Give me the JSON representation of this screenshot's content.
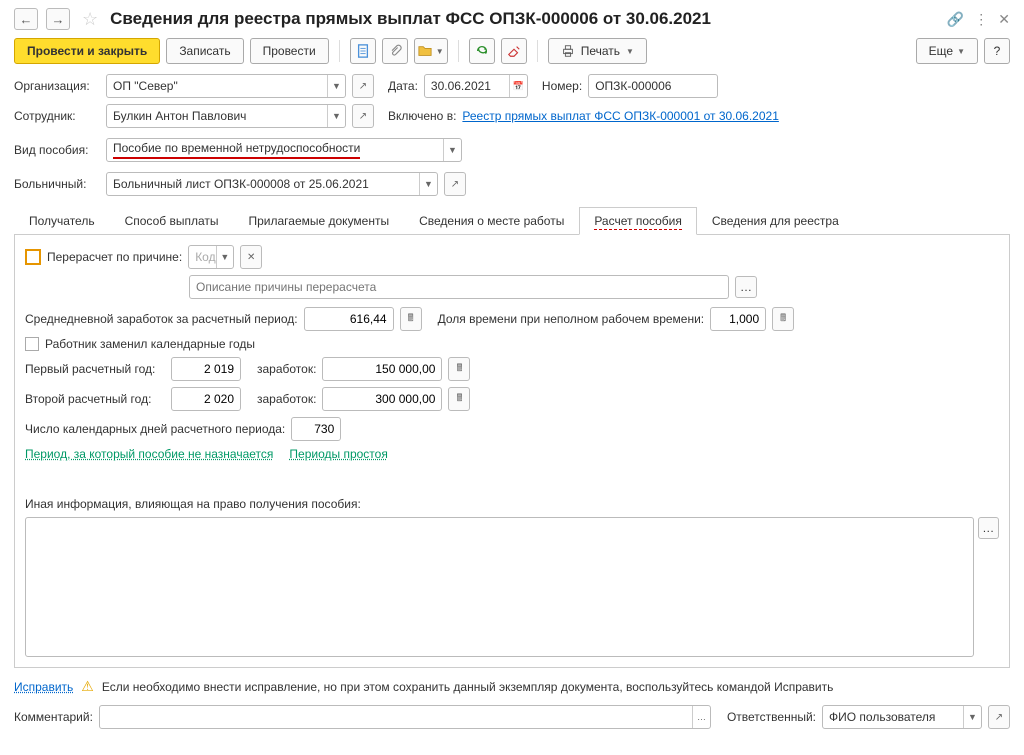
{
  "title": "Сведения для реестра прямых выплат ФСС ОПЗК-000006 от 30.06.2021",
  "toolbar": {
    "post_close": "Провести и закрыть",
    "save": "Записать",
    "post": "Провести",
    "print": "Печать",
    "more": "Еще"
  },
  "form": {
    "org_label": "Организация:",
    "org_value": "ОП \"Север\"",
    "date_label": "Дата:",
    "date_value": "30.06.2021",
    "num_label": "Номер:",
    "num_value": "ОПЗК-000006",
    "emp_label": "Сотрудник:",
    "emp_value": "Булкин Антон Павлович",
    "included_label": "Включено в:",
    "included_link": "Реестр прямых выплат ФСС ОПЗК-000001 от 30.06.2021",
    "benefit_label": "Вид пособия:",
    "benefit_value": "Пособие по временной нетрудоспособности",
    "sick_label": "Больничный:",
    "sick_value": "Больничный лист ОПЗК-000008 от 25.06.2021"
  },
  "tabs": [
    "Получатель",
    "Способ выплаты",
    "Прилагаемые документы",
    "Сведения о месте работы",
    "Расчет пособия",
    "Сведения для реестра"
  ],
  "calc": {
    "recalc_label": "Перерасчет по причине:",
    "code_placeholder": "Код",
    "reason_placeholder": "Описание причины перерасчета",
    "avg_label": "Среднедневной заработок за расчетный период:",
    "avg_value": "616,44",
    "share_label": "Доля времени при неполном рабочем времени:",
    "share_value": "1,000",
    "replaced_label": "Работник заменил календарные годы",
    "year1_label": "Первый расчетный год:",
    "year1_value": "2 019",
    "year2_label": "Второй расчетный год:",
    "year2_value": "2 020",
    "earn_label": "заработок:",
    "earn1_value": "150 000,00",
    "earn2_value": "300 000,00",
    "days_label": "Число календарных дней расчетного периода:",
    "days_value": "730",
    "link1": "Период, за который пособие не назначается",
    "link2": "Периоды простоя",
    "other_label": "Иная информация, влияющая на право получения пособия:"
  },
  "footer": {
    "fix_link": "Исправить",
    "fix_text": "Если необходимо внести исправление, но при этом сохранить данный экземпляр документа, воспользуйтесь командой Исправить",
    "comment_label": "Комментарий:",
    "resp_label": "Ответственный:",
    "resp_value": "ФИО пользователя"
  }
}
